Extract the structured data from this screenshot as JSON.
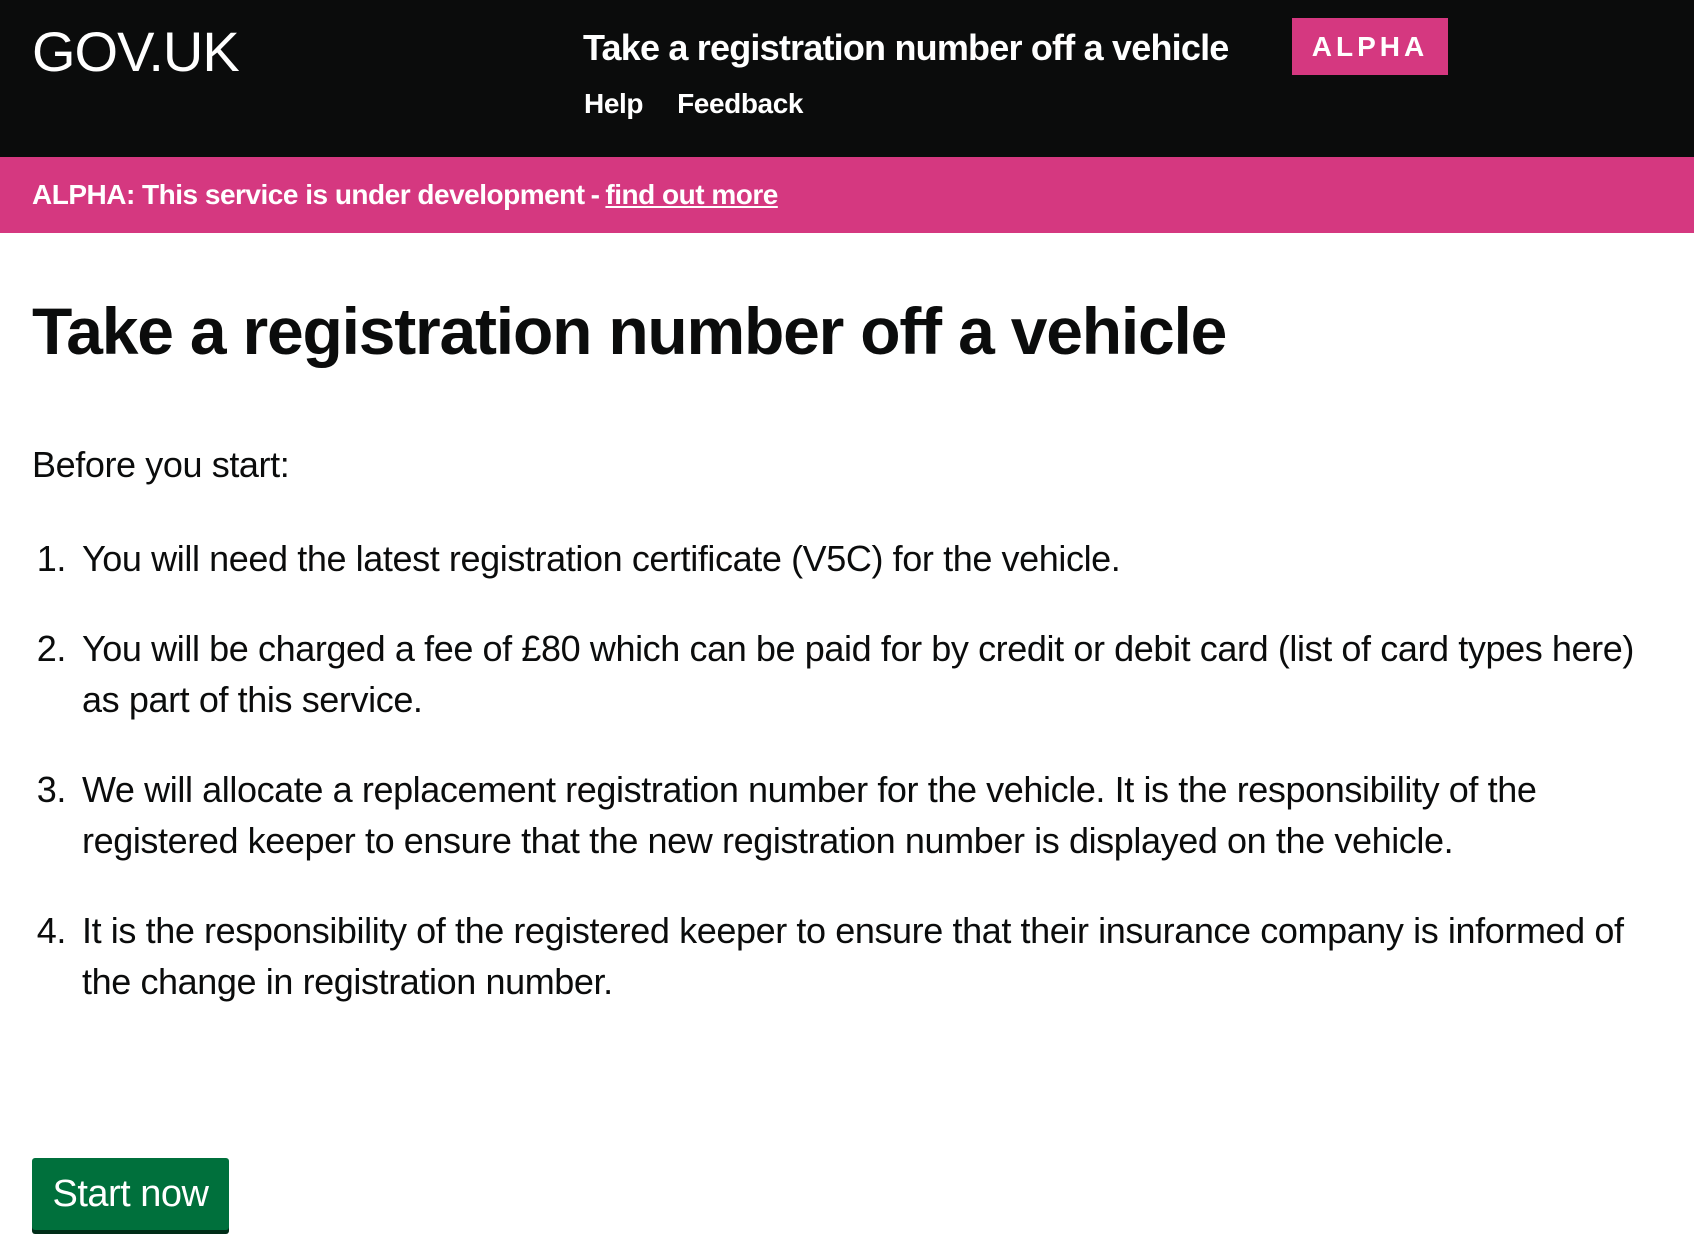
{
  "header": {
    "logo": "GOV.UK",
    "service_name": "Take a registration number off a vehicle",
    "phase_tag": "ALPHA",
    "nav": [
      {
        "label": "Help"
      },
      {
        "label": "Feedback"
      }
    ]
  },
  "phase_banner": {
    "text": "ALPHA: This service is under development",
    "separator": "-",
    "link_text": "find out more"
  },
  "main": {
    "title": "Take a registration number off a vehicle",
    "intro": "Before you start:",
    "steps": [
      {
        "number": "1.",
        "text": "You will need the latest registration certificate (V5C) for the vehicle."
      },
      {
        "number": "2.",
        "text": "You will be charged a fee of £80 which can be paid for by credit or debit card (list of card types here) as part of this service."
      },
      {
        "number": "3.",
        "text": "We will allocate a replacement registration number for the vehicle. It is the responsibility of the registered keeper to ensure that the new registration number is displayed on the vehicle."
      },
      {
        "number": "4.",
        "text": "It is the responsibility of the registered keeper to ensure that their insurance company is informed of the change in registration number."
      }
    ],
    "start_button": "Start now"
  },
  "colors": {
    "header_bg": "#0b0c0c",
    "alpha_pink": "#d53880",
    "button_green": "#00703c"
  }
}
